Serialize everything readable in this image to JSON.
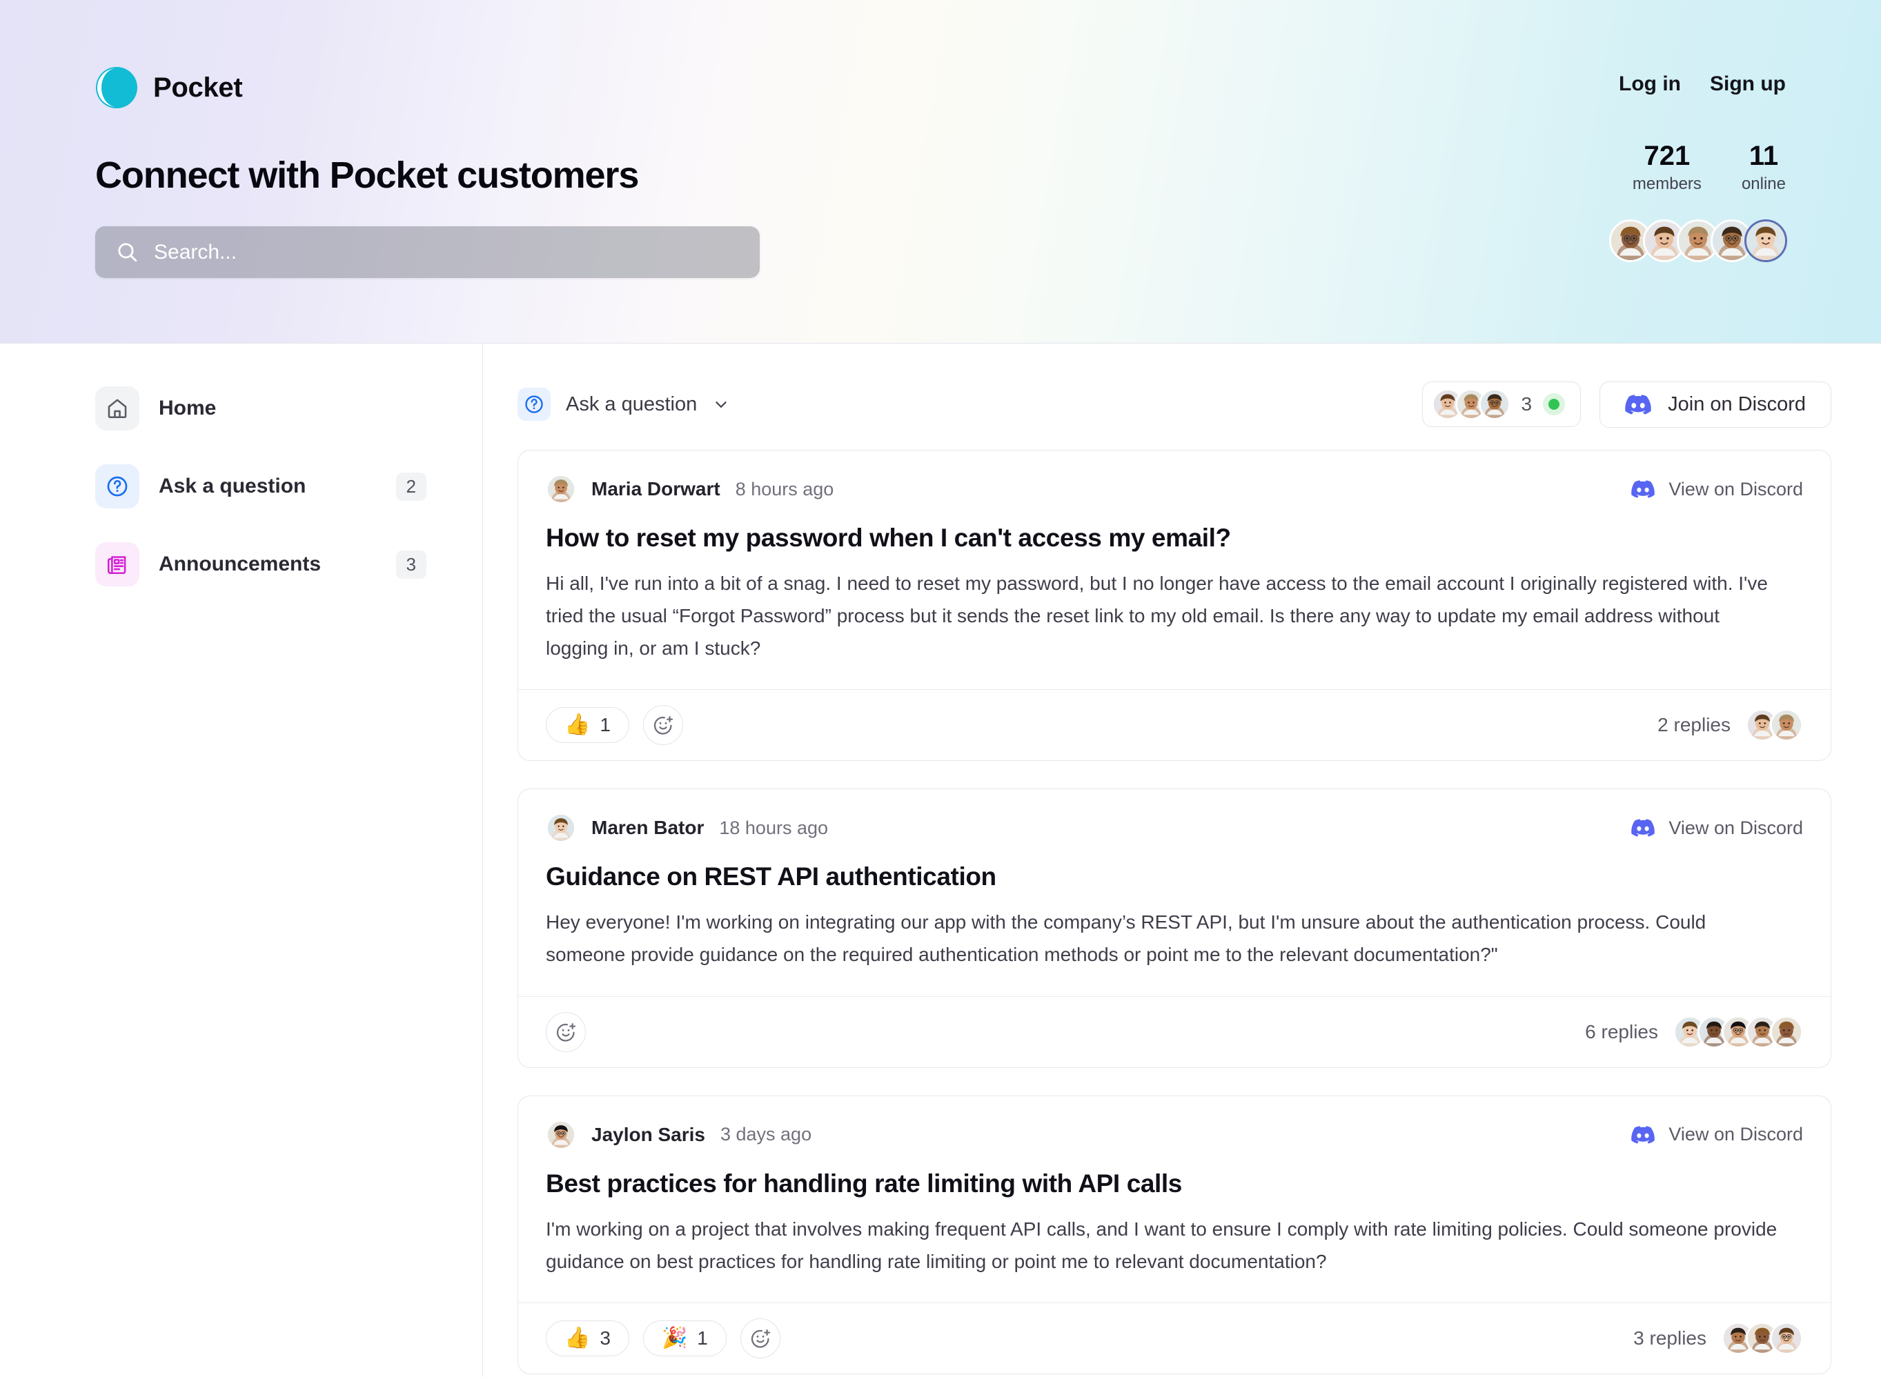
{
  "header": {
    "brand_name": "Pocket",
    "logo_icon": "pocket-half-circle-logo",
    "accent_color": "#12bcd4",
    "login_label": "Log in",
    "signup_label": "Sign up",
    "page_title": "Connect with Pocket customers",
    "search": {
      "icon": "search-icon",
      "placeholder": "Search...",
      "value": ""
    },
    "stats": [
      {
        "number": "721",
        "label": "members"
      },
      {
        "number": "11",
        "label": "online"
      }
    ]
  },
  "sidebar": {
    "items": [
      {
        "label": "Home",
        "icon": "home-icon",
        "badge": "",
        "active": false
      },
      {
        "label": "Ask a question",
        "icon": "question-circle-icon",
        "badge": "2",
        "active": false
      },
      {
        "label": "Announcements",
        "icon": "newspaper-icon",
        "badge": "3",
        "active": false
      }
    ]
  },
  "main": {
    "channel": {
      "label": "Ask a question",
      "icon": "question-circle-icon",
      "chevron": "chevron-down-icon"
    },
    "online": {
      "count": "3",
      "status_dot_color": "#31c454"
    },
    "join_button": {
      "label": "Join on Discord",
      "icon": "discord-icon",
      "brand_color": "#5865f2"
    },
    "view_on_discord_label": "View on Discord",
    "posts": [
      {
        "author": "Maria Dorwart",
        "time": "8 hours ago",
        "title": "How to reset my password when I can't access my email?",
        "text": "Hi all, I've run into a bit of a snag. I need to reset my password, but I no longer have access to the email account I originally registered with. I've tried the usual “Forgot Password” process but it sends the reset link to my old email. Is there any way to update my email address without logging in, or am I stuck?",
        "reactions": [
          {
            "emoji": "👍",
            "count": "1"
          }
        ],
        "add_reaction_icon": "add-reaction-icon",
        "replies_label": "2 replies",
        "reply_avatar_count": 2
      },
      {
        "author": "Maren Bator",
        "time": "18 hours ago",
        "title": "Guidance on REST API authentication",
        "text": "Hey everyone! I'm working on integrating our app with the company’s REST API, but I'm unsure about the authentication process. Could someone provide guidance on the required authentication methods or point me to the relevant documentation?\"",
        "reactions": [],
        "add_reaction_icon": "add-reaction-icon",
        "replies_label": "6 replies",
        "reply_avatar_count": 5
      },
      {
        "author": "Jaylon Saris",
        "time": "3 days ago",
        "title": "Best practices for handling rate limiting with API calls",
        "text": "I'm working on a project that involves making frequent API calls, and I want to ensure I comply with rate limiting policies. Could someone provide guidance on best practices for handling rate limiting or point me to relevant documentation?",
        "reactions": [
          {
            "emoji": "👍",
            "count": "3"
          },
          {
            "emoji": "🎉",
            "count": "1"
          }
        ],
        "add_reaction_icon": "add-reaction-icon",
        "replies_label": "3 replies",
        "reply_avatar_count": 3
      }
    ]
  }
}
